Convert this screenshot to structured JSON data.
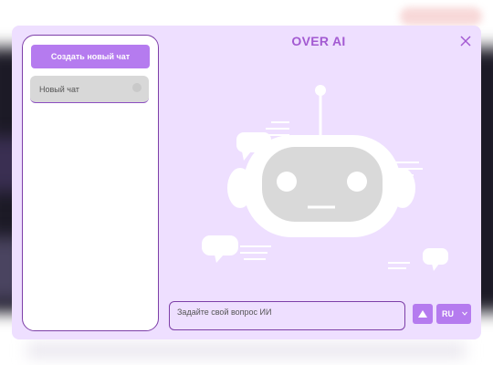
{
  "app": {
    "title": "OVER AI"
  },
  "sidebar": {
    "new_chat_label": "Создать новый чат",
    "chats": [
      {
        "label": "Новый чат"
      }
    ]
  },
  "composer": {
    "placeholder": "Задайте свой вопрос ИИ",
    "send_icon": "arrow-up-icon",
    "language": "RU"
  },
  "icons": {
    "close": "close-icon",
    "chevron": "chevron-down-icon",
    "illustration": "robot-illustration"
  },
  "colors": {
    "accent": "#b57bef",
    "title": "#a35ad2",
    "panel": "#eedfff",
    "border": "#7d3fa8",
    "robot_face": "#d9d9d9"
  }
}
